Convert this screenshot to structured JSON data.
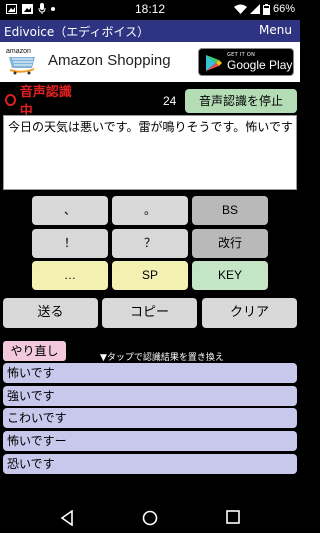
{
  "status_bar": {
    "time": "18:12",
    "battery": "66%",
    "left_icons": [
      "image-icon",
      "photo-icon",
      "mic-icon",
      "dot-icon"
    ],
    "right_icons": [
      "wifi-icon",
      "signal-icon",
      "battery-icon"
    ]
  },
  "app_bar": {
    "title": "Edivoice（エディボイス）",
    "menu": "Menu"
  },
  "ad": {
    "logo_word": "amazon",
    "text": "Amazon Shopping",
    "badge_small": "GET IT ON",
    "badge_big": "Google Play"
  },
  "recognition": {
    "status": "音声認識中",
    "count": "24",
    "stop_button": "音声認識を停止"
  },
  "text_area": {
    "value": "今日の天気は悪いです。雷が鳴りそうです。怖いです"
  },
  "keypad": {
    "rows": [
      [
        "、",
        "。",
        "BS"
      ],
      [
        "！",
        "？",
        "改行"
      ],
      [
        "…",
        "SP",
        "KEY"
      ]
    ]
  },
  "actions": {
    "send": "送る",
    "copy": "コピー",
    "clear": "クリア"
  },
  "redo_button": "やり直し",
  "hint": "▼タップで認識結果を置き換え",
  "candidates": [
    "怖いです",
    "強いです",
    "こわいです",
    "怖いですー",
    "恐いです"
  ],
  "colors": {
    "app_bar": "#2f3482",
    "recording": "#e02020",
    "stop_button": "#b4ddb6",
    "candidate": "#c8c8ed",
    "redo": "#f1c8dc"
  }
}
